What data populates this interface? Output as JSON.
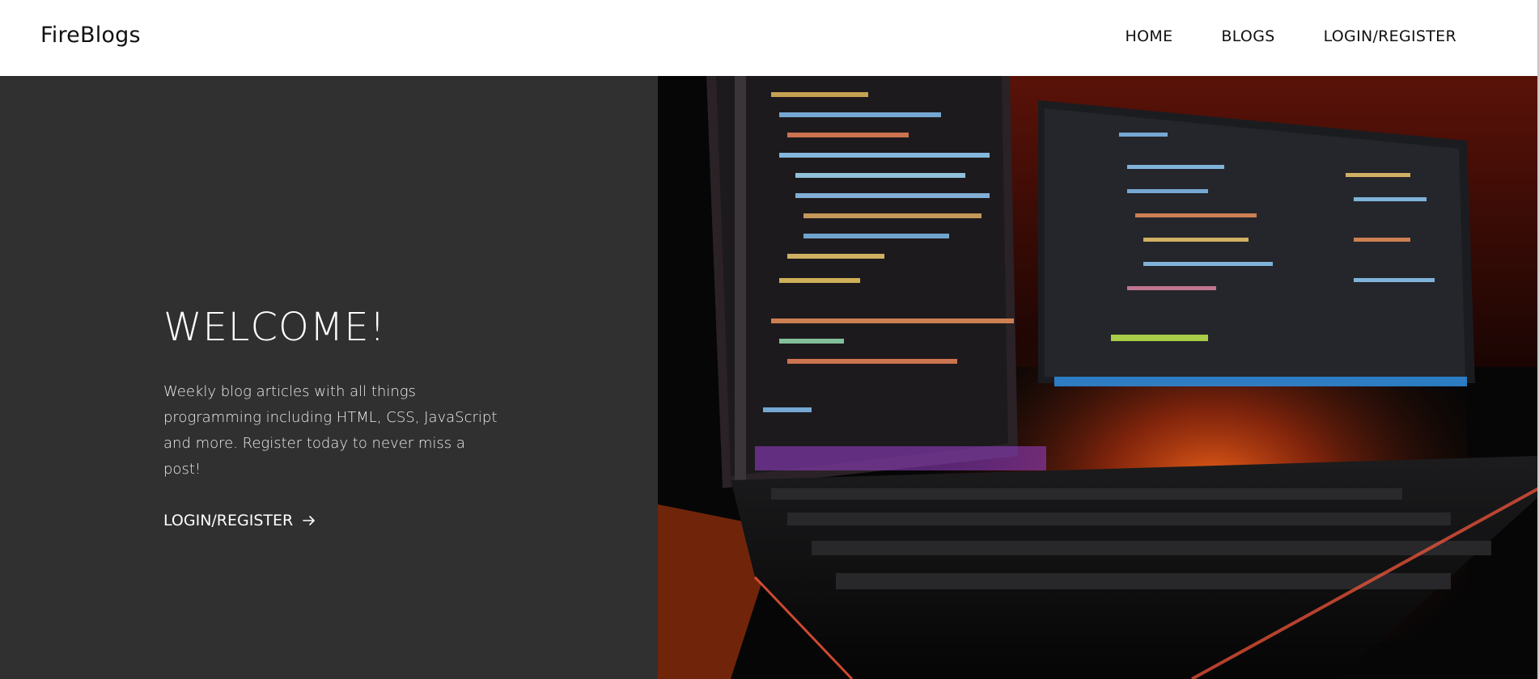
{
  "header": {
    "logo": "FireBlogs",
    "nav": [
      {
        "label": "HOME"
      },
      {
        "label": "BLOGS"
      },
      {
        "label": "LOGIN/REGISTER"
      }
    ]
  },
  "hero": {
    "title": "WELCOME!",
    "description_lines": [
      "Weekly blog articles with all things",
      "programming including HTML, CSS, JavaScript",
      "and more. Register today to never miss a post!"
    ],
    "cta_label": "LOGIN/REGISTER",
    "cta_icon": "arrow-right-icon",
    "image_icon": "hero-photo-monitors-keyboard"
  },
  "colors": {
    "hero_bg": "#303030",
    "header_bg": "#ffffff",
    "text_light": "#ffffff",
    "accent_orange": "#e8541a"
  }
}
